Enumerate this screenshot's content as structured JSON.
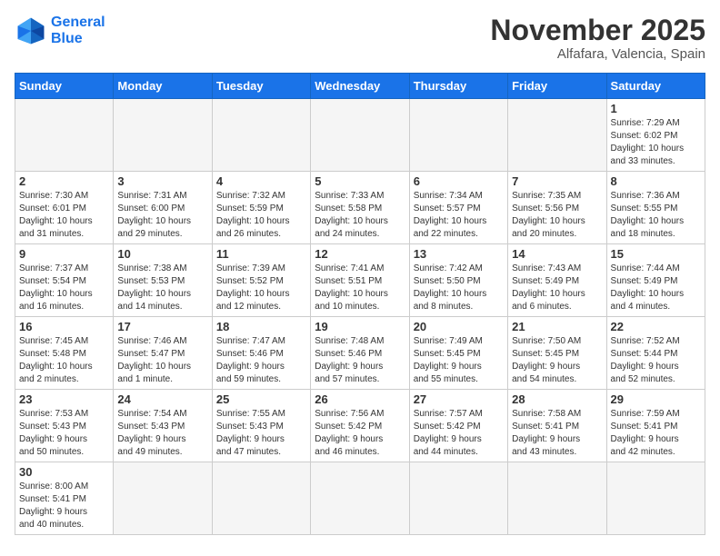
{
  "logo": {
    "line1": "General",
    "line2": "Blue"
  },
  "title": "November 2025",
  "subtitle": "Alfafara, Valencia, Spain",
  "header_days": [
    "Sunday",
    "Monday",
    "Tuesday",
    "Wednesday",
    "Thursday",
    "Friday",
    "Saturday"
  ],
  "weeks": [
    [
      {
        "day": "",
        "info": ""
      },
      {
        "day": "",
        "info": ""
      },
      {
        "day": "",
        "info": ""
      },
      {
        "day": "",
        "info": ""
      },
      {
        "day": "",
        "info": ""
      },
      {
        "day": "",
        "info": ""
      },
      {
        "day": "1",
        "info": "Sunrise: 7:29 AM\nSunset: 6:02 PM\nDaylight: 10 hours\nand 33 minutes."
      }
    ],
    [
      {
        "day": "2",
        "info": "Sunrise: 7:30 AM\nSunset: 6:01 PM\nDaylight: 10 hours\nand 31 minutes."
      },
      {
        "day": "3",
        "info": "Sunrise: 7:31 AM\nSunset: 6:00 PM\nDaylight: 10 hours\nand 29 minutes."
      },
      {
        "day": "4",
        "info": "Sunrise: 7:32 AM\nSunset: 5:59 PM\nDaylight: 10 hours\nand 26 minutes."
      },
      {
        "day": "5",
        "info": "Sunrise: 7:33 AM\nSunset: 5:58 PM\nDaylight: 10 hours\nand 24 minutes."
      },
      {
        "day": "6",
        "info": "Sunrise: 7:34 AM\nSunset: 5:57 PM\nDaylight: 10 hours\nand 22 minutes."
      },
      {
        "day": "7",
        "info": "Sunrise: 7:35 AM\nSunset: 5:56 PM\nDaylight: 10 hours\nand 20 minutes."
      },
      {
        "day": "8",
        "info": "Sunrise: 7:36 AM\nSunset: 5:55 PM\nDaylight: 10 hours\nand 18 minutes."
      }
    ],
    [
      {
        "day": "9",
        "info": "Sunrise: 7:37 AM\nSunset: 5:54 PM\nDaylight: 10 hours\nand 16 minutes."
      },
      {
        "day": "10",
        "info": "Sunrise: 7:38 AM\nSunset: 5:53 PM\nDaylight: 10 hours\nand 14 minutes."
      },
      {
        "day": "11",
        "info": "Sunrise: 7:39 AM\nSunset: 5:52 PM\nDaylight: 10 hours\nand 12 minutes."
      },
      {
        "day": "12",
        "info": "Sunrise: 7:41 AM\nSunset: 5:51 PM\nDaylight: 10 hours\nand 10 minutes."
      },
      {
        "day": "13",
        "info": "Sunrise: 7:42 AM\nSunset: 5:50 PM\nDaylight: 10 hours\nand 8 minutes."
      },
      {
        "day": "14",
        "info": "Sunrise: 7:43 AM\nSunset: 5:49 PM\nDaylight: 10 hours\nand 6 minutes."
      },
      {
        "day": "15",
        "info": "Sunrise: 7:44 AM\nSunset: 5:49 PM\nDaylight: 10 hours\nand 4 minutes."
      }
    ],
    [
      {
        "day": "16",
        "info": "Sunrise: 7:45 AM\nSunset: 5:48 PM\nDaylight: 10 hours\nand 2 minutes."
      },
      {
        "day": "17",
        "info": "Sunrise: 7:46 AM\nSunset: 5:47 PM\nDaylight: 10 hours\nand 1 minute."
      },
      {
        "day": "18",
        "info": "Sunrise: 7:47 AM\nSunset: 5:46 PM\nDaylight: 9 hours\nand 59 minutes."
      },
      {
        "day": "19",
        "info": "Sunrise: 7:48 AM\nSunset: 5:46 PM\nDaylight: 9 hours\nand 57 minutes."
      },
      {
        "day": "20",
        "info": "Sunrise: 7:49 AM\nSunset: 5:45 PM\nDaylight: 9 hours\nand 55 minutes."
      },
      {
        "day": "21",
        "info": "Sunrise: 7:50 AM\nSunset: 5:45 PM\nDaylight: 9 hours\nand 54 minutes."
      },
      {
        "day": "22",
        "info": "Sunrise: 7:52 AM\nSunset: 5:44 PM\nDaylight: 9 hours\nand 52 minutes."
      }
    ],
    [
      {
        "day": "23",
        "info": "Sunrise: 7:53 AM\nSunset: 5:43 PM\nDaylight: 9 hours\nand 50 minutes."
      },
      {
        "day": "24",
        "info": "Sunrise: 7:54 AM\nSunset: 5:43 PM\nDaylight: 9 hours\nand 49 minutes."
      },
      {
        "day": "25",
        "info": "Sunrise: 7:55 AM\nSunset: 5:43 PM\nDaylight: 9 hours\nand 47 minutes."
      },
      {
        "day": "26",
        "info": "Sunrise: 7:56 AM\nSunset: 5:42 PM\nDaylight: 9 hours\nand 46 minutes."
      },
      {
        "day": "27",
        "info": "Sunrise: 7:57 AM\nSunset: 5:42 PM\nDaylight: 9 hours\nand 44 minutes."
      },
      {
        "day": "28",
        "info": "Sunrise: 7:58 AM\nSunset: 5:41 PM\nDaylight: 9 hours\nand 43 minutes."
      },
      {
        "day": "29",
        "info": "Sunrise: 7:59 AM\nSunset: 5:41 PM\nDaylight: 9 hours\nand 42 minutes."
      }
    ],
    [
      {
        "day": "30",
        "info": "Sunrise: 8:00 AM\nSunset: 5:41 PM\nDaylight: 9 hours\nand 40 minutes."
      },
      {
        "day": "",
        "info": ""
      },
      {
        "day": "",
        "info": ""
      },
      {
        "day": "",
        "info": ""
      },
      {
        "day": "",
        "info": ""
      },
      {
        "day": "",
        "info": ""
      },
      {
        "day": "",
        "info": ""
      }
    ]
  ]
}
